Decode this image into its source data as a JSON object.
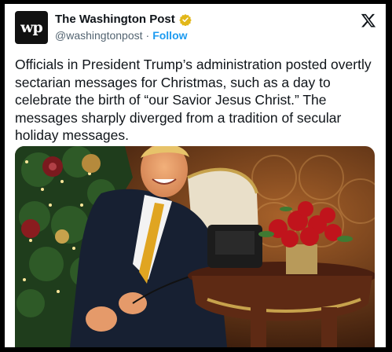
{
  "account": {
    "avatar_text": "wp",
    "name": "The Washington Post",
    "verified_icon": "verified-gold-badge",
    "handle": "@washingtonpost",
    "separator": "·",
    "follow_label": "Follow"
  },
  "platform_icon": "x-logo",
  "tweet": {
    "text": "Officials in President Trump’s administration posted overtly sectarian messages for Christmas, such as a day to celebrate the birth of “our Savior Jesus Christ.” The messages sharply diverged from a tradition of secular holiday messages."
  },
  "colors": {
    "link": "#1d9bf0",
    "verified_gold": "#e2b719",
    "text": "#0f1419",
    "muted": "#536471"
  }
}
